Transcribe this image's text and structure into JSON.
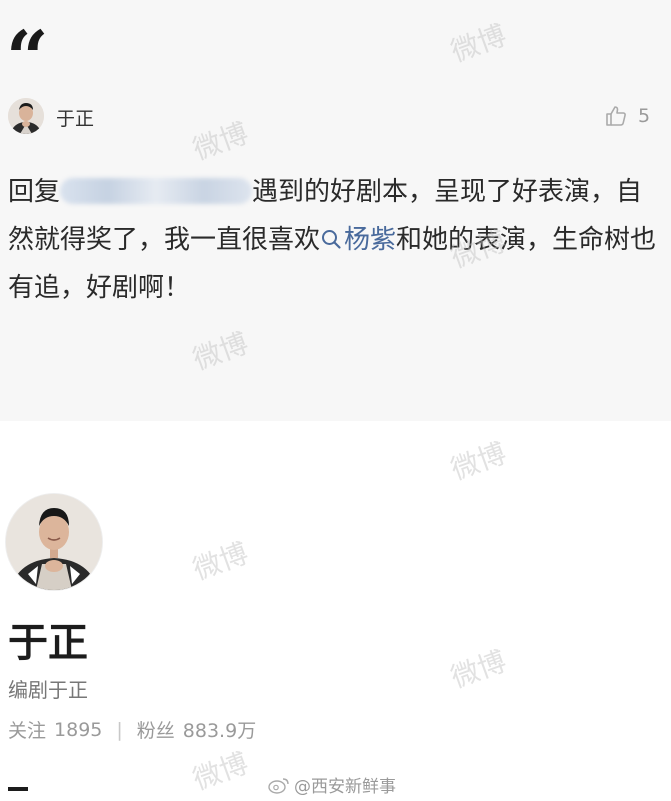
{
  "comment": {
    "quote_mark": "“",
    "author": "于正",
    "likes": "5",
    "text_before": "回复",
    "text_after_mention": "遇到的好剧本，呈现了好表演，自然就得奖了，我一直很喜欢",
    "topic": "杨紫",
    "text_end": "和她的表演，生命树也有追，好剧啊！"
  },
  "profile": {
    "name": "于正",
    "bio": "编剧于正",
    "follow_label": "关注",
    "follow_count": "1895",
    "separator": "|",
    "fans_label": "粉丝",
    "fans_count": "883.9万"
  },
  "watermark": {
    "text": "微博",
    "source": "@西安新鲜事"
  },
  "colors": {
    "card_bg": "#f7f7f7",
    "topic_blue": "#496a9c",
    "muted": "#9a9a9a"
  }
}
